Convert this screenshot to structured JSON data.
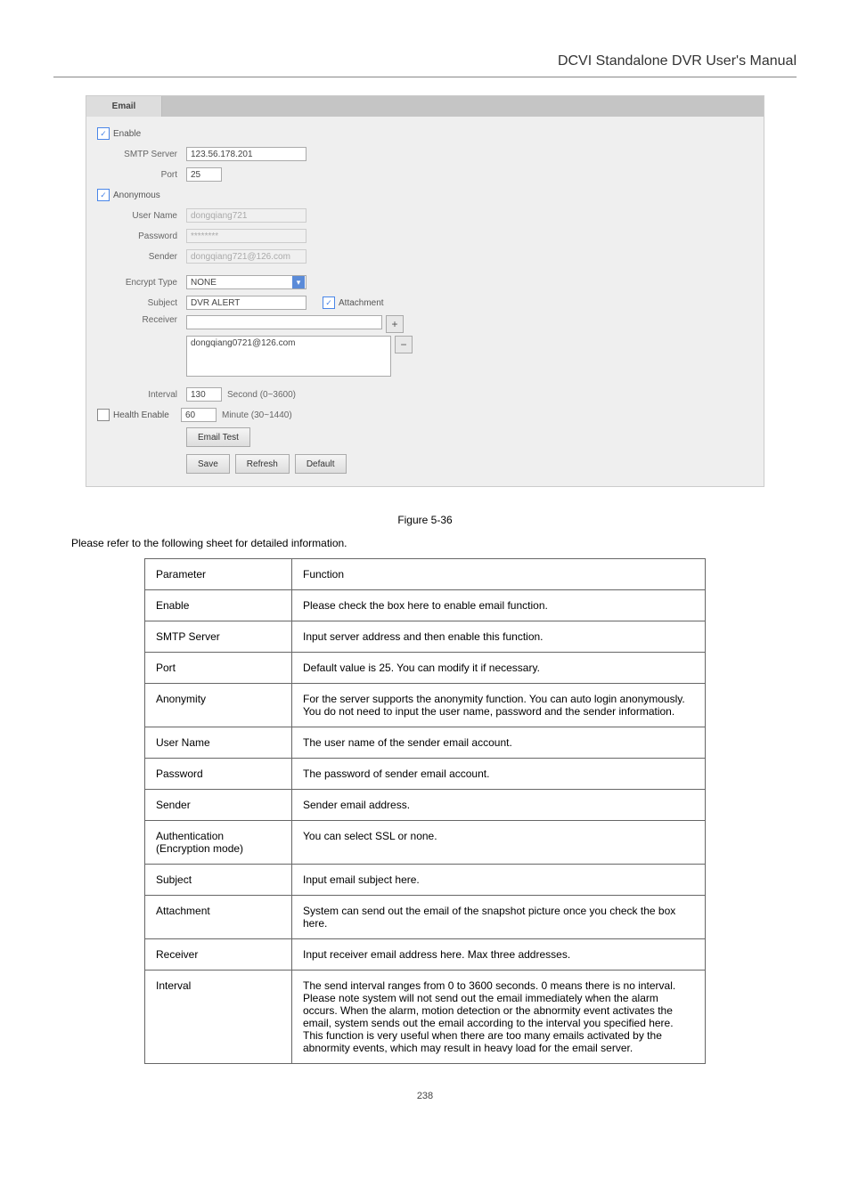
{
  "header": {
    "title": "DCVI Standalone DVR User's Manual"
  },
  "tab": {
    "label": "Email"
  },
  "form": {
    "enable": {
      "label": "Enable",
      "checked": true
    },
    "smtp": {
      "label": "SMTP Server",
      "value": "123.56.178.201"
    },
    "port": {
      "label": "Port",
      "value": "25"
    },
    "anon": {
      "label": "Anonymous",
      "checked": true
    },
    "user": {
      "label": "User Name",
      "value": "dongqiang721"
    },
    "pass": {
      "label": "Password",
      "value": "********"
    },
    "sender": {
      "label": "Sender",
      "value": "dongqiang721@126.com"
    },
    "encrypt": {
      "label": "Encrypt Type",
      "value": "NONE"
    },
    "subject": {
      "label": "Subject",
      "value": "DVR ALERT"
    },
    "attach": {
      "label": "Attachment",
      "checked": true
    },
    "receiver": {
      "label": "Receiver",
      "add_value": "",
      "list": "dongqiang0721@126.com"
    },
    "interval": {
      "label": "Interval",
      "value": "130",
      "unit": "Second (0~3600)"
    },
    "health": {
      "label": "Health Enable",
      "checked": false,
      "value": "60",
      "unit": "Minute (30~1440)"
    },
    "buttons": {
      "test": "Email Test",
      "save": "Save",
      "refresh": "Refresh",
      "def": "Default"
    }
  },
  "figure_caption": "Figure 5-36",
  "intro_text": "Please refer to the following sheet for detailed information.",
  "table": {
    "head": {
      "param": "Parameter",
      "func": "Function"
    },
    "rows": [
      {
        "param": "Enable",
        "func": "Please check the box here to enable email function."
      },
      {
        "param": "SMTP Server",
        "func": "Input server address and then enable this function."
      },
      {
        "param": "Port",
        "func": "Default value is 25. You can modify it if necessary."
      },
      {
        "param": "Anonymity",
        "func": "For the server supports the anonymity function. You can auto login anonymously. You do not need to input the user name, password and the sender information."
      },
      {
        "param": "User Name",
        "func": "The user name of the sender email account."
      },
      {
        "param": "Password",
        "func": "The password of sender email account."
      },
      {
        "param": "Sender",
        "func": "Sender email address."
      },
      {
        "param": "Authentication (Encryption mode)",
        "func": "You can select SSL or none."
      },
      {
        "param": "Subject",
        "func": "Input email subject here."
      },
      {
        "param": "Attachment",
        "func": "System can send out the email of the snapshot picture once you check the box here."
      },
      {
        "param": "Receiver",
        "func": "Input receiver email address here. Max three addresses."
      },
      {
        "param": "Interval",
        "func": "The send interval ranges from 0 to 3600 seconds. 0 means there is no interval.\nPlease note system will not send out the email immediately when the alarm occurs. When the alarm, motion detection or the abnormity event activates the email, system sends out the email according to the interval you specified here. This function is very useful when there are too many emails activated by the abnormity events, which may result in heavy load for the email server."
      }
    ]
  },
  "page_number": "238"
}
